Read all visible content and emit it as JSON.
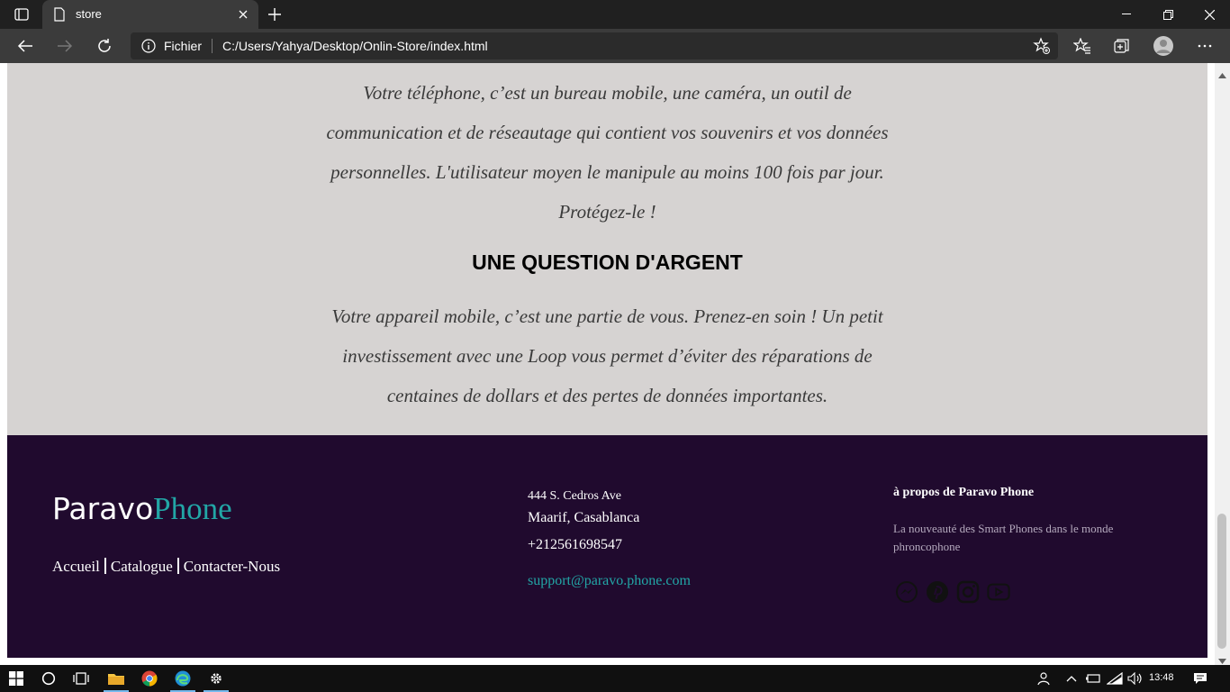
{
  "browser": {
    "tab_title": "store",
    "scheme_label": "Fichier",
    "url": "C:/Users/Yahya/Desktop/Onlin-Store/index.html"
  },
  "content": {
    "paragraph1_lines": [
      "Votre téléphone, c’est un bureau mobile, une caméra, un outil de",
      "communication et de réseautage qui contient vos souvenirs et vos données",
      "personnelles. L'utilisateur moyen le manipule au moins 100 fois par jour.",
      "Protégez-le !"
    ],
    "heading2": "UNE QUESTION D'ARGENT",
    "paragraph2_lines": [
      "Votre appareil mobile, c’est une partie de vous. Prenez-en soin ! Un petit",
      "investissement avec une Loop vous permet d’éviter des réparations de",
      "centaines de dollars et des pertes de données importantes."
    ]
  },
  "footer": {
    "logo_part1": "Paravo",
    "logo_part2": "Phone",
    "nav": [
      "Accueil",
      "Catalogue",
      "Contacter-Nous"
    ],
    "address_line1": "444 S. Cedros Ave",
    "address_line2": "Maarif, Casablanca",
    "phone": "+212561698547",
    "email": "support@paravo.phone.com",
    "about_title": "à propos de Paravo Phone",
    "about_text": "La nouveauté des Smart Phones dans le monde phroncophone",
    "social_icons": [
      "messenger-icon",
      "pinterest-icon",
      "instagram-icon",
      "youtube-icon"
    ]
  },
  "taskbar": {
    "clock": "13:48"
  },
  "colors": {
    "content_bg": "#d6d3d2",
    "footer_bg": "#200a2e",
    "accent": "#22a6a6"
  }
}
